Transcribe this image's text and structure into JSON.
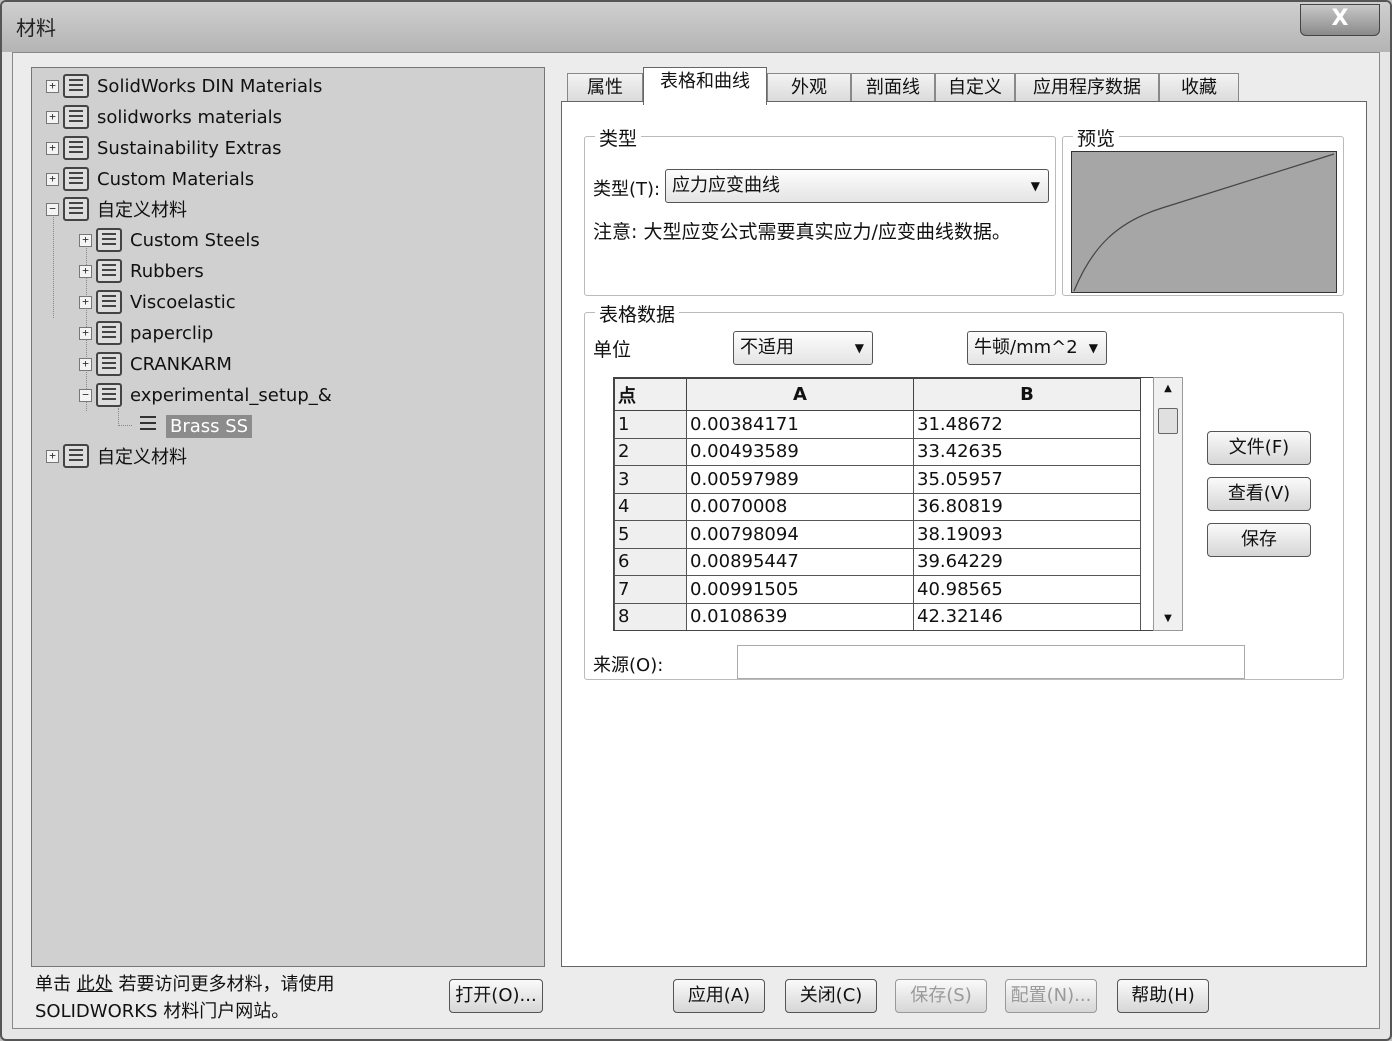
{
  "window": {
    "title": "材料",
    "close_symbol": "X"
  },
  "tree": {
    "items": [
      {
        "label": "SolidWorks DIN Materials",
        "expander": "+"
      },
      {
        "label": "solidworks materials",
        "expander": "+"
      },
      {
        "label": "Sustainability Extras",
        "expander": "+"
      },
      {
        "label": "Custom Materials",
        "expander": "+"
      },
      {
        "label": "自定义材料",
        "expander": "−"
      },
      {
        "label": "Custom Steels",
        "expander": "+"
      },
      {
        "label": "Rubbers",
        "expander": "+"
      },
      {
        "label": "Viscoelastic",
        "expander": "+"
      },
      {
        "label": "paperclip",
        "expander": "+"
      },
      {
        "label": "CRANKARM",
        "expander": "+"
      },
      {
        "label": "experimental_setup_&",
        "expander": "−"
      },
      {
        "label": "Brass SS",
        "expander": ""
      },
      {
        "label": "自定义材料",
        "expander": "+"
      }
    ]
  },
  "footer_note": {
    "prefix": "单击",
    "link": "此处",
    "suffix": "若要访问更多材料，请使用",
    "line2": "SOLIDWORKS 材料门户网站。"
  },
  "buttons": {
    "open": "打开(O)...",
    "apply": "应用(A)",
    "close": "关闭(C)",
    "save": "保存(S)",
    "config": "配置(N)...",
    "help": "帮助(H)"
  },
  "tabs": [
    "属性",
    "表格和曲线",
    "外观",
    "剖面线",
    "自定义",
    "应用程序数据",
    "收藏"
  ],
  "active_tab": "表格和曲线",
  "type_group": {
    "title": "类型",
    "label": "类型(T):",
    "value": "应力应变曲线",
    "note": "注意: 大型应变公式需要真实应力/应变曲线数据。"
  },
  "preview": {
    "title": "预览"
  },
  "table_group": {
    "title": "表格数据",
    "units_label": "单位",
    "unit_a": "不适用",
    "unit_b": "牛顿/mm^2",
    "columns": [
      "点",
      "A",
      "B"
    ],
    "rows": [
      [
        "1",
        "0.00384171",
        "31.48672"
      ],
      [
        "2",
        "0.00493589",
        "33.42635"
      ],
      [
        "3",
        "0.00597989",
        "35.05957"
      ],
      [
        "4",
        "0.0070008",
        "36.80819"
      ],
      [
        "5",
        "0.00798094",
        "38.19093"
      ],
      [
        "6",
        "0.00895447",
        "39.64229"
      ],
      [
        "7",
        "0.00991505",
        "40.98565"
      ],
      [
        "8",
        "0.0108639",
        "42.32146"
      ]
    ],
    "side_buttons": {
      "file": "文件(F)",
      "view": "查看(V)",
      "save": "保存"
    },
    "source_label": "来源(O):",
    "source_value": ""
  }
}
